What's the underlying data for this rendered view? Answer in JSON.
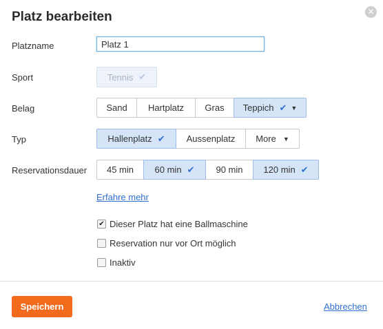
{
  "dialog": {
    "title": "Platz bearbeiten",
    "close_icon": "close-icon",
    "close_glyph": "✕"
  },
  "fields": {
    "name_label": "Platzname",
    "name_value": "Platz 1",
    "sport_label": "Sport",
    "sport_value": "Tennis",
    "belag_label": "Belag",
    "typ_label": "Typ",
    "dauer_label": "Reservationsdauer"
  },
  "belag": [
    {
      "label": "Sand",
      "selected": false
    },
    {
      "label": "Hartplatz",
      "selected": false
    },
    {
      "label": "Gras",
      "selected": false
    },
    {
      "label": "Teppich",
      "selected": true
    }
  ],
  "typ": [
    {
      "label": "Hallenplatz",
      "selected": true
    },
    {
      "label": "Aussenplatz",
      "selected": false
    },
    {
      "label": "More",
      "selected": false
    }
  ],
  "dauer": [
    {
      "label": "45 min",
      "selected": false
    },
    {
      "label": "60 min",
      "selected": true
    },
    {
      "label": "90 min",
      "selected": false
    },
    {
      "label": "120 min",
      "selected": true
    }
  ],
  "link_label": "Erfahre mehr",
  "checkboxes": [
    {
      "label": "Dieser Platz hat eine Ballmaschine",
      "checked": true
    },
    {
      "label": "Reservation nur vor Ort möglich",
      "checked": false
    },
    {
      "label": "Inaktiv",
      "checked": false
    }
  ],
  "footer": {
    "save_label": "Speichern",
    "cancel_label": "Abbrechen"
  },
  "icons": {
    "check": "✔",
    "caret": "▼"
  },
  "colors": {
    "accent": "#f26b1d",
    "selected_bg": "#d6e4f7",
    "link": "#2f6fd0"
  }
}
